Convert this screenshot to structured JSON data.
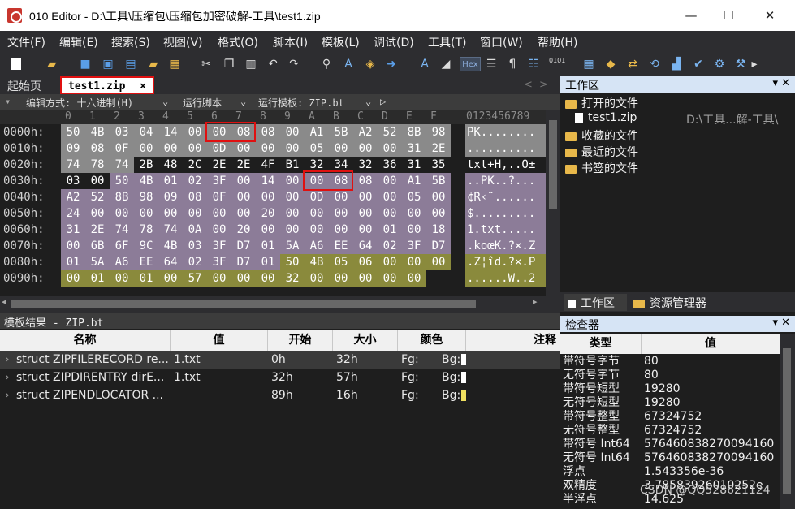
{
  "window": {
    "title": "010 Editor - D:\\工具\\压缩包\\压缩包加密破解-工具\\test1.zip",
    "minimize": "—",
    "maximize": "☐",
    "close": "✕"
  },
  "menu": [
    "文件(F)",
    "编辑(E)",
    "搜索(S)",
    "视图(V)",
    "格式(O)",
    "脚本(I)",
    "模板(L)",
    "调试(D)",
    "工具(T)",
    "窗口(W)",
    "帮助(H)"
  ],
  "toolbar": {
    "hex_label": "Hex",
    "paragraph": "¶",
    "binary": "0101"
  },
  "tabs": {
    "start": "起始页",
    "active": "test1.zip",
    "close": "×",
    "nav_left": "<",
    "nav_right": ">"
  },
  "options": {
    "edit_mode": "编辑方式: 十六进制(H)",
    "run_script": "运行脚本",
    "run_template": "运行模板: ZIP.bt"
  },
  "hex": {
    "col_headers": [
      "0",
      "1",
      "2",
      "3",
      "4",
      "5",
      "6",
      "7",
      "8",
      "9",
      "A",
      "B",
      "C",
      "D",
      "E",
      "F"
    ],
    "ascii_header": "0123456789",
    "offsets": [
      "0000h:",
      "0010h:",
      "0020h:",
      "0030h:",
      "0040h:",
      "0050h:",
      "0060h:",
      "0070h:",
      "0080h:",
      "0090h:"
    ],
    "rows": [
      [
        "50",
        "4B",
        "03",
        "04",
        "14",
        "00",
        "00",
        "08",
        "08",
        "00",
        "A1",
        "5B",
        "A2",
        "52",
        "8B",
        "98"
      ],
      [
        "09",
        "08",
        "0F",
        "00",
        "00",
        "00",
        "0D",
        "00",
        "00",
        "00",
        "05",
        "00",
        "00",
        "00",
        "31",
        "2E"
      ],
      [
        "74",
        "78",
        "74",
        "2B",
        "48",
        "2C",
        "2E",
        "2E",
        "4F",
        "B1",
        "32",
        "34",
        "32",
        "36",
        "31",
        "35"
      ],
      [
        "03",
        "00",
        "50",
        "4B",
        "01",
        "02",
        "3F",
        "00",
        "14",
        "00",
        "00",
        "08",
        "08",
        "00",
        "A1",
        "5B"
      ],
      [
        "A2",
        "52",
        "8B",
        "98",
        "09",
        "08",
        "0F",
        "00",
        "00",
        "00",
        "0D",
        "00",
        "00",
        "00",
        "05",
        "00"
      ],
      [
        "24",
        "00",
        "00",
        "00",
        "00",
        "00",
        "00",
        "00",
        "20",
        "00",
        "00",
        "00",
        "00",
        "00",
        "00",
        "00"
      ],
      [
        "31",
        "2E",
        "74",
        "78",
        "74",
        "0A",
        "00",
        "20",
        "00",
        "00",
        "00",
        "00",
        "00",
        "01",
        "00",
        "18"
      ],
      [
        "00",
        "6B",
        "6F",
        "9C",
        "4B",
        "03",
        "3F",
        "D7",
        "01",
        "5A",
        "A6",
        "EE",
        "64",
        "02",
        "3F",
        "D7"
      ],
      [
        "01",
        "5A",
        "A6",
        "EE",
        "64",
        "02",
        "3F",
        "D7",
        "01",
        "50",
        "4B",
        "05",
        "06",
        "00",
        "00",
        "00"
      ],
      [
        "00",
        "01",
        "00",
        "01",
        "00",
        "57",
        "00",
        "00",
        "00",
        "32",
        "00",
        "00",
        "00",
        "00",
        "00",
        ""
      ]
    ],
    "ascii": [
      "PK........",
      "..........",
      "txt+H,..O±",
      "..PK..?...",
      "¢R‹˜......",
      "$.........",
      "1.txt.....",
      ".koœK.?×.Z",
      ".Z¦îd.?×.P",
      "......W..2"
    ]
  },
  "template": {
    "title": "模板结果 - ZIP.bt",
    "columns": [
      "名称",
      "值",
      "开始",
      "大小",
      "颜色",
      "注释"
    ],
    "rows": [
      {
        "name": "struct ZIPFILERECORD re...",
        "value": "1.txt",
        "start": "0h",
        "size": "32h",
        "fg": "Fg:",
        "bg": "Bg:",
        "bgcolor": "#ffffff"
      },
      {
        "name": "struct ZIPDIRENTRY dirE...",
        "value": "1.txt",
        "start": "32h",
        "size": "57h",
        "fg": "Fg:",
        "bg": "Bg:",
        "bgcolor": "#ffffff"
      },
      {
        "name": "struct ZIPENDLOCATOR ...",
        "value": "",
        "start": "89h",
        "size": "16h",
        "fg": "Fg:",
        "bg": "Bg:",
        "bgcolor": "#f0e060"
      }
    ]
  },
  "workspace": {
    "title": "工作区",
    "open_files": "打开的文件",
    "file_name": "test1.zip",
    "file_path": "D:\\工具...解-工具\\",
    "favorites": "收藏的文件",
    "recent": "最近的文件",
    "bookmarks": "书签的文件",
    "tab_workspace": "工作区",
    "tab_explorer": "资源管理器"
  },
  "inspector": {
    "title": "检查器",
    "col_type": "类型",
    "col_value": "值",
    "rows": [
      {
        "type": "带符号字节",
        "value": "80"
      },
      {
        "type": "无符号字节",
        "value": "80"
      },
      {
        "type": "带符号短型",
        "value": "19280"
      },
      {
        "type": "无符号短型",
        "value": "19280"
      },
      {
        "type": "带符号整型",
        "value": "67324752"
      },
      {
        "type": "无符号整型",
        "value": "67324752"
      },
      {
        "type": "带符号 Int64",
        "value": "576460838270094160"
      },
      {
        "type": "无符号 Int64",
        "value": "576460838270094160"
      },
      {
        "type": "浮点",
        "value": "1.543356e-36"
      },
      {
        "type": "双精度",
        "value": "3.78583926010252e"
      },
      {
        "type": "半浮点",
        "value": "14.625"
      }
    ]
  },
  "watermark": "CSDN @QQ528621124",
  "colors": {
    "sel_bg": "#8a8a8a",
    "lavender": "#8c7c98",
    "olive": "#8a8a3c",
    "dark": "#1e1e1e"
  }
}
